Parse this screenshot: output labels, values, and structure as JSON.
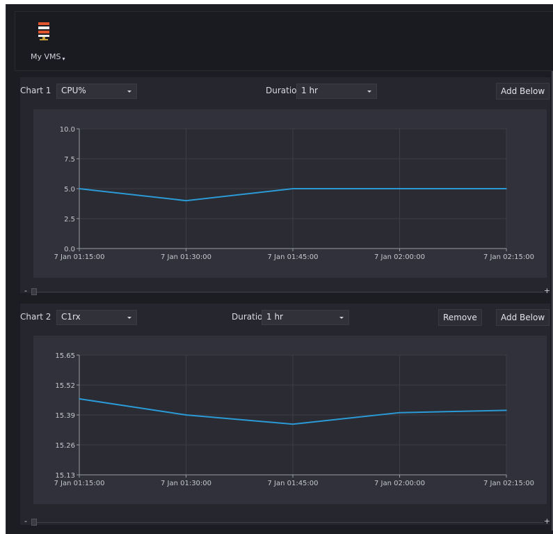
{
  "header": {
    "app_menu_label": "My VMS",
    "icon": "server-stack-icon"
  },
  "charts": [
    {
      "label": "Chart 1",
      "metric": "CPU%",
      "duration_label": "Duration",
      "duration": "1 hr",
      "buttons": [
        "Add Below"
      ],
      "chart_data": {
        "type": "line",
        "x": [
          "7 Jan 01:15:00",
          "7 Jan 01:30:00",
          "7 Jan 01:45:00",
          "7 Jan 02:00:00",
          "7 Jan 02:15:00"
        ],
        "series": [
          {
            "values": [
              5.0,
              4.0,
              5.0,
              5.0,
              5.0
            ],
            "color": "#2a9bd6"
          }
        ],
        "yticks": [
          "0.0",
          "2.5",
          "5.0",
          "7.5",
          "10.0"
        ],
        "ylim": [
          0,
          10
        ],
        "grid": true
      }
    },
    {
      "label": "Chart 2",
      "metric": "C1rx",
      "duration_label": "Duration",
      "duration": "1 hr",
      "buttons": [
        "Remove",
        "Add Below"
      ],
      "chart_data": {
        "type": "line",
        "x": [
          "7 Jan 01:15:00",
          "7 Jan 01:30:00",
          "7 Jan 01:45:00",
          "7 Jan 02:00:00",
          "7 Jan 02:15:00"
        ],
        "series": [
          {
            "values": [
              15.46,
              15.39,
              15.35,
              15.4,
              15.41
            ],
            "color": "#2a9bd6"
          }
        ],
        "yticks": [
          "15.13",
          "15.26",
          "15.39",
          "15.52",
          "15.65"
        ],
        "ylim": [
          15.13,
          15.65
        ],
        "grid": true
      }
    }
  ],
  "slider": {
    "minus": "-",
    "plus": "+"
  }
}
